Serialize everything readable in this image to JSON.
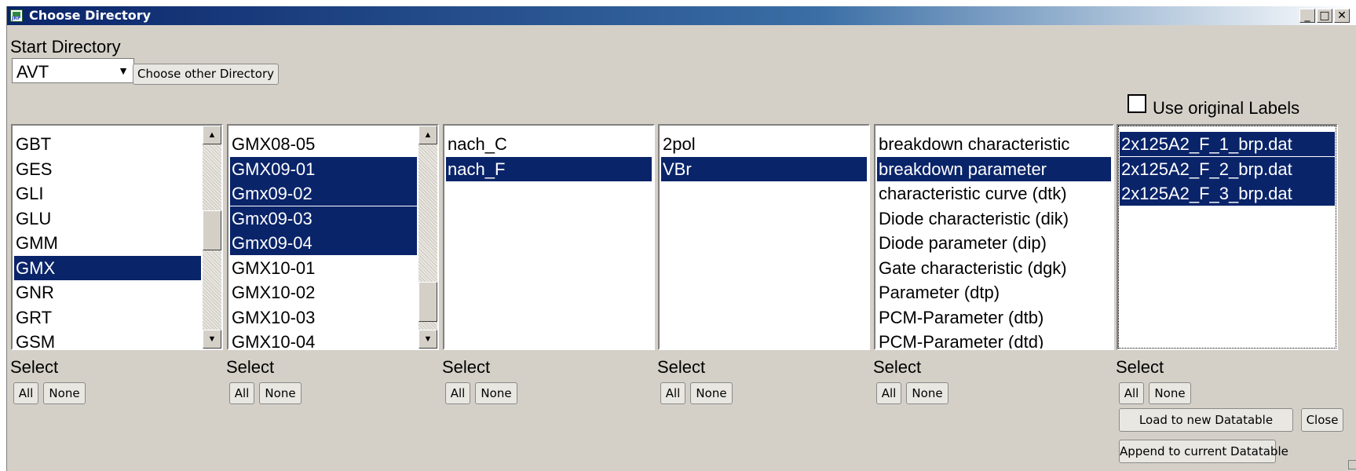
{
  "window": {
    "title": "Choose Directory",
    "controls": [
      "_",
      "□",
      "✕"
    ]
  },
  "start_directory": {
    "label": "Start Directory",
    "selected": "AVT",
    "choose_other_label": "Choose other Directory"
  },
  "use_original_labels": {
    "label": "Use original Labels",
    "checked": false
  },
  "lists": [
    {
      "items": [
        "GBT",
        "GES",
        "GLI",
        "GLU",
        "GMM",
        "GMX",
        "GNR",
        "GRT",
        "GSM"
      ],
      "selected": [
        5
      ],
      "scrollbar": true,
      "thumb_fraction": [
        0.38,
        0.56
      ]
    },
    {
      "items": [
        "GMX08-05",
        "GMX09-01",
        "Gmx09-02",
        "Gmx09-03",
        "Gmx09-04",
        "GMX10-01",
        "GMX10-02",
        "GMX10-03",
        "GMX10-04"
      ],
      "selected": [
        1,
        2,
        3,
        4
      ],
      "scrollbar": true,
      "thumb_fraction": [
        0.7,
        0.88
      ]
    },
    {
      "items": [
        "nach_C",
        "nach_F"
      ],
      "selected": [
        1
      ],
      "scrollbar": false
    },
    {
      "items": [
        "2pol",
        "VBr"
      ],
      "selected": [
        1
      ],
      "scrollbar": false
    },
    {
      "items": [
        "breakdown characteristic",
        "breakdown parameter",
        "characteristic curve (dtk)",
        "Diode characteristic (dik)",
        "Diode parameter (dip)",
        "Gate characteristic (dgk)",
        "Parameter (dtp)",
        "PCM-Parameter (dtb)",
        "PCM-Parameter (dtd)"
      ],
      "selected": [
        1
      ],
      "scrollbar": false
    },
    {
      "items": [
        "2x125A2_F_1_brp.dat",
        "2x125A2_F_2_brp.dat",
        "2x125A2_F_3_brp.dat"
      ],
      "selected": [
        0,
        1,
        2
      ],
      "scrollbar": false,
      "focused": true
    }
  ],
  "select_group": {
    "label": "Select",
    "all_label": "All",
    "none_label": "None"
  },
  "actions": {
    "load_new": "Load to new Datatable",
    "close": "Close",
    "append": "Append to current Datatable"
  },
  "colors": {
    "selection": "#0a246a",
    "window_bg": "#d4d0c8",
    "title_start": "#0a246a"
  }
}
